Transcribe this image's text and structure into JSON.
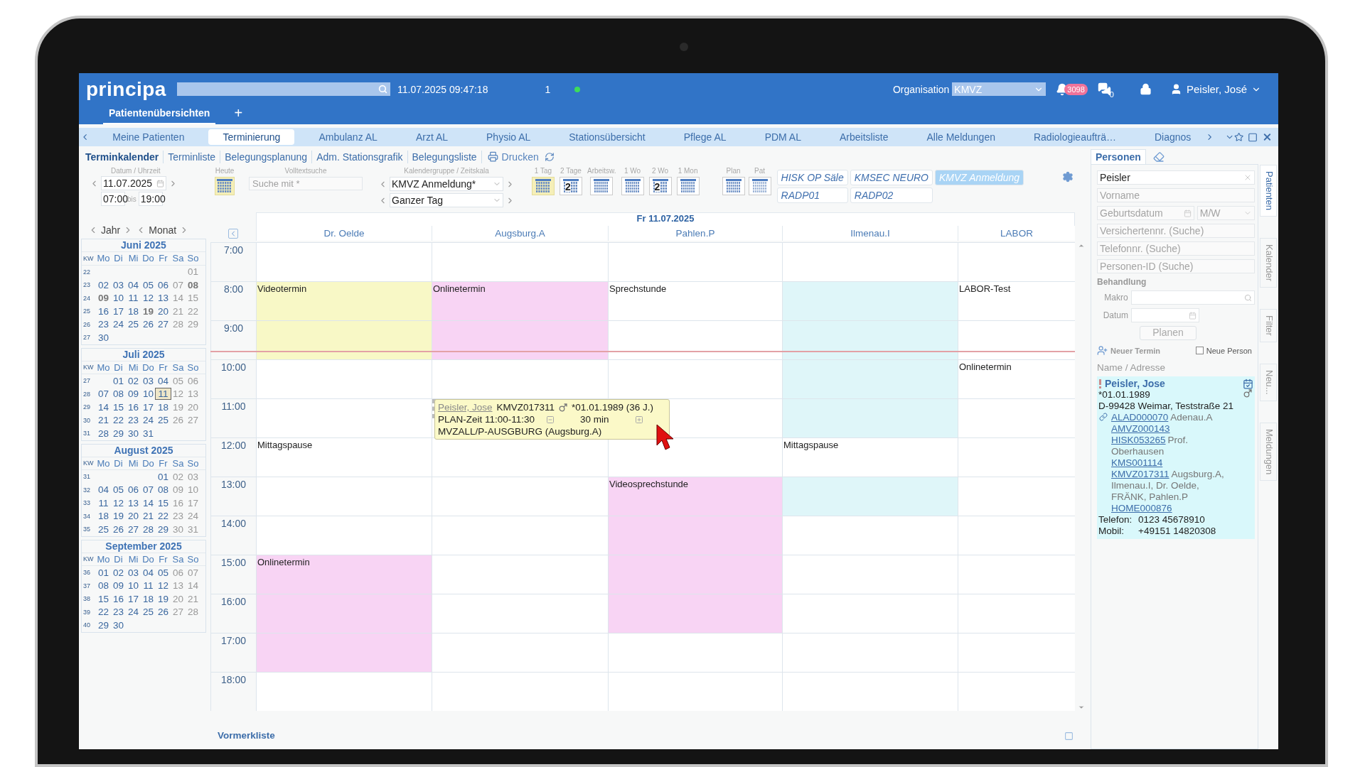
{
  "header": {
    "logo": "principa",
    "datetime": "11.07.2025 09:47:18",
    "session_count": "1",
    "organisation_label": "Organisation",
    "organisation_value": "KMVZ",
    "notifications": "3098",
    "messages": "0",
    "user": "Peisler, José"
  },
  "workspace_tabs": [
    {
      "label": "Patientenübersichten",
      "selected": true
    }
  ],
  "add_tab": "+",
  "nav_tabs": [
    {
      "label": "Meine Patienten",
      "selected": false
    },
    {
      "label": "Terminierung",
      "selected": true
    },
    {
      "label": "Ambulanz AL",
      "selected": false
    },
    {
      "label": "Arzt AL",
      "selected": false
    },
    {
      "label": "Physio AL",
      "selected": false
    },
    {
      "label": "Stationsübersicht",
      "selected": false
    },
    {
      "label": "Pflege AL",
      "selected": false
    },
    {
      "label": "PDM AL",
      "selected": false
    },
    {
      "label": "Arbeitsliste",
      "selected": false
    },
    {
      "label": "Alle Meldungen",
      "selected": false
    },
    {
      "label": "Radiologieaufträ…",
      "selected": false
    },
    {
      "label": "Diagnos",
      "selected": false
    }
  ],
  "sub_tabs": [
    {
      "label": "Terminkalender",
      "selected": true
    },
    {
      "label": "Terminliste",
      "selected": false
    },
    {
      "label": "Belegungsplanung",
      "selected": false
    },
    {
      "label": "Adm. Stationsgrafik",
      "selected": false
    },
    {
      "label": "Belegungsliste",
      "selected": false
    }
  ],
  "print": "Drucken",
  "date_controls": {
    "label": "Datum / Uhrzeit",
    "date": "11.07.2025",
    "time_from": "07:00",
    "bis": "bis",
    "time_to": "19:00"
  },
  "today": {
    "label": "Heute"
  },
  "fulltext": {
    "label": "Volltextsuche",
    "placeholder": "Suche mit *"
  },
  "group": {
    "label": "Kalendergruppe / Zeitskala",
    "value": "KMVZ Anmeldung*",
    "scale": "Ganzer Tag"
  },
  "views": [
    {
      "label": "1 Tag",
      "kind": "day",
      "selected": true
    },
    {
      "label": "2 Tage",
      "kind": "days",
      "digit": "2",
      "selected": false
    },
    {
      "label": "Arbeitsw.",
      "kind": "week",
      "selected": false
    },
    {
      "label": "1 Wo",
      "kind": "week",
      "selected": false
    },
    {
      "label": "2 Wo",
      "kind": "days",
      "digit": "2",
      "selected": false
    },
    {
      "label": "1 Mon",
      "kind": "month",
      "selected": false
    }
  ],
  "plan_views": [
    {
      "label": "Plan",
      "kind": "plan"
    },
    {
      "label": "Pat",
      "kind": "pat"
    }
  ],
  "groups": [
    {
      "label": "HISK OP Säle",
      "selected": false
    },
    {
      "label": "KMSEC NEURO",
      "selected": false
    },
    {
      "label": "KMVZ Anmeldung",
      "selected": true
    },
    {
      "label": "RADP01",
      "selected": false
    },
    {
      "label": "RADP02",
      "selected": false
    }
  ],
  "mini_nav": {
    "year": "Jahr",
    "month": "Monat"
  },
  "months": [
    {
      "title": "Juni 2025",
      "head": [
        "KW",
        "Mo",
        "Di",
        "Mi",
        "Do",
        "Fr",
        "Sa",
        "So"
      ],
      "weeks": [
        {
          "kw": "22",
          "days": [
            "01"
          ]
        },
        {
          "kw": "23",
          "days": [
            "02",
            "03",
            "04",
            "05",
            "06",
            "07",
            {
              "text": "08",
              "holiday": true
            }
          ]
        },
        {
          "kw": "24",
          "days": [
            {
              "text": "09",
              "holiday": true
            },
            "10",
            "11",
            "12",
            "13",
            "14",
            "15"
          ]
        },
        {
          "kw": "25",
          "days": [
            "16",
            "17",
            "18",
            {
              "text": "19",
              "holiday": true
            },
            "20",
            "21",
            "22"
          ]
        },
        {
          "kw": "26",
          "days": [
            "23",
            "24",
            "25",
            "26",
            "27",
            "28",
            "29"
          ]
        },
        {
          "kw": "27",
          "days": [
            "30"
          ]
        }
      ]
    },
    {
      "title": "Juli 2025",
      "head": [
        "KW",
        "Mo",
        "Di",
        "Mi",
        "Do",
        "Fr",
        "Sa",
        "So"
      ],
      "weeks": [
        {
          "kw": "27",
          "days": [
            "01",
            "02",
            "03",
            "04",
            "05",
            "06"
          ]
        },
        {
          "kw": "28",
          "days": [
            "07",
            "08",
            "09",
            "10",
            {
              "text": "11",
              "selected": true
            },
            "12",
            "13"
          ]
        },
        {
          "kw": "29",
          "days": [
            "14",
            "15",
            "16",
            "17",
            "18",
            "19",
            "20"
          ]
        },
        {
          "kw": "30",
          "days": [
            "21",
            "22",
            "23",
            "24",
            "25",
            "26",
            "27"
          ]
        },
        {
          "kw": "31",
          "days": [
            "28",
            "29",
            "30",
            "31"
          ]
        }
      ]
    },
    {
      "title": "August 2025",
      "head": [
        "KW",
        "Mo",
        "Di",
        "Mi",
        "Do",
        "Fr",
        "Sa",
        "So"
      ],
      "weeks": [
        {
          "kw": "31",
          "days": [
            "01",
            "02",
            "03"
          ]
        },
        {
          "kw": "32",
          "days": [
            "04",
            "05",
            "06",
            "07",
            "08",
            "09",
            "10"
          ]
        },
        {
          "kw": "33",
          "days": [
            "11",
            "12",
            "13",
            "14",
            "15",
            "16",
            "17"
          ]
        },
        {
          "kw": "34",
          "days": [
            "18",
            "19",
            "20",
            "21",
            "22",
            "23",
            "24"
          ]
        },
        {
          "kw": "35",
          "days": [
            "25",
            "26",
            "27",
            "28",
            "29",
            "30",
            "31"
          ]
        }
      ]
    },
    {
      "title": "September 2025",
      "head": [
        "KW",
        "Mo",
        "Di",
        "Mi",
        "Do",
        "Fr",
        "Sa",
        "So"
      ],
      "weeks": [
        {
          "kw": "36",
          "days": [
            "01",
            "02",
            "03",
            "04",
            "05",
            "06",
            "07"
          ]
        },
        {
          "kw": "37",
          "days": [
            "08",
            "09",
            "10",
            "11",
            "12",
            "13",
            "14"
          ]
        },
        {
          "kw": "38",
          "days": [
            "15",
            "16",
            "17",
            "18",
            "19",
            "20",
            "21"
          ]
        },
        {
          "kw": "39",
          "days": [
            "22",
            "23",
            "24",
            "25",
            "26",
            "27",
            "28"
          ]
        },
        {
          "kw": "40",
          "days": [
            "29",
            "30"
          ]
        }
      ]
    }
  ],
  "calendar": {
    "date": "Fr 11.07.2025",
    "times": [
      "7:00",
      "8:00",
      "9:00",
      "10:00",
      "11:00",
      "12:00",
      "13:00",
      "14:00",
      "15:00",
      "16:00",
      "17:00",
      "18:00"
    ],
    "columns": [
      {
        "name": "Dr. Oelde",
        "hours": [
          {
            "kind": "free"
          },
          {
            "kind": "event",
            "label": "Videotermin",
            "color": "#f8f8c6"
          },
          {
            "kind": "event",
            "color": "#f8f8c6"
          },
          {
            "kind": "free"
          },
          {
            "kind": "free"
          },
          {
            "kind": "event",
            "label": "Mittagspause"
          },
          {
            "kind": "free"
          },
          {
            "kind": "free"
          },
          {
            "kind": "event",
            "label": "Onlinetermin",
            "color": "#f8d4f4"
          },
          {
            "kind": "event",
            "color": "#f8d4f4"
          },
          {
            "kind": "event",
            "color": "#f8d4f4"
          },
          {
            "kind": "free"
          }
        ]
      },
      {
        "name": "Augsburg.A",
        "hours": [
          {
            "kind": "free"
          },
          {
            "kind": "event",
            "label": "Onlinetermin",
            "color": "#f8d4f4"
          },
          {
            "kind": "event",
            "color": "#f8d4f4"
          },
          {
            "kind": "free"
          },
          {
            "kind": "planned"
          },
          {
            "kind": "free"
          },
          {
            "kind": "free"
          },
          {
            "kind": "free"
          },
          {
            "kind": "free"
          },
          {
            "kind": "free"
          },
          {
            "kind": "free"
          },
          {
            "kind": "free"
          }
        ]
      },
      {
        "name": "Pahlen.P",
        "hours": [
          {
            "kind": "free"
          },
          {
            "kind": "event",
            "label": "Sprechstunde"
          },
          {
            "kind": "free"
          },
          {
            "kind": "free"
          },
          {
            "kind": "free"
          },
          {
            "kind": "free"
          },
          {
            "kind": "event",
            "label": "Videosprechstunde",
            "color": "#f8d4f4"
          },
          {
            "kind": "event",
            "color": "#f8d4f4"
          },
          {
            "kind": "event",
            "color": "#f8d4f4"
          },
          {
            "kind": "event",
            "color": "#f8d4f4"
          },
          {
            "kind": "free"
          },
          {
            "kind": "free"
          }
        ]
      },
      {
        "name": "Ilmenau.I",
        "hours": [
          {
            "kind": "free"
          },
          {
            "kind": "event",
            "color": "#dff6f9"
          },
          {
            "kind": "event",
            "color": "#dff6f9"
          },
          {
            "kind": "event",
            "color": "#dff6f9"
          },
          {
            "kind": "event",
            "color": "#dff6f9"
          },
          {
            "kind": "event",
            "label": "Mittagspause"
          },
          {
            "kind": "event",
            "color": "#dff6f9"
          },
          {
            "kind": "free"
          },
          {
            "kind": "free"
          },
          {
            "kind": "free"
          },
          {
            "kind": "free"
          },
          {
            "kind": "free"
          }
        ]
      },
      {
        "name": "LABOR",
        "hours": [
          {
            "kind": "free"
          },
          {
            "kind": "event",
            "label": "LABOR-Test"
          },
          {
            "kind": "free"
          },
          {
            "kind": "event",
            "label": "Onlinetermin"
          },
          {
            "kind": "free"
          },
          {
            "kind": "free"
          },
          {
            "kind": "free"
          },
          {
            "kind": "free"
          },
          {
            "kind": "free"
          },
          {
            "kind": "free"
          },
          {
            "kind": "free"
          },
          {
            "kind": "free"
          }
        ]
      }
    ],
    "tooltip": {
      "patient": "Peisler, Jose",
      "case": "KMVZ017311",
      "birth": "*01.01.1989  (36 J.)",
      "plan": "PLAN-Zeit 11:00-11:30",
      "duration": "30 min",
      "location": "MVZALL/P-AUSGBURG  (Augsburg.A)"
    }
  },
  "footer": {
    "label": "Vormerkliste"
  },
  "persons": {
    "tab": "Personen",
    "name_value": "Peisler",
    "firstname_placeholder": "Vorname",
    "birth_placeholder": "Geburtsdatum",
    "sex_placeholder": "M/W",
    "insurance_placeholder": "Versichertennr. (Suche)",
    "phone_placeholder": "Telefonnr. (Suche)",
    "id_placeholder": "Personen-ID (Suche)",
    "treatment": "Behandlung",
    "macro_label": "Makro",
    "date_label": "Datum",
    "plan_button": "Planen",
    "new_appointment": "Neuer Termin",
    "new_person": {
      "label": "Neue Person",
      "checked": false
    },
    "list_header": "Name / Adresse",
    "result": {
      "name": "Peisler, Jose",
      "birth": "*01.01.1989",
      "address": "D-99428 Weimar, Teststraße 21",
      "ids": [
        {
          "id": "ALAD000070",
          "note": "Adenau.A"
        },
        {
          "id": "AMVZ000143"
        },
        {
          "id": "HISK053265",
          "note": "Prof. Oberhausen"
        },
        {
          "id": "KMS001114"
        },
        {
          "id": "KMVZ017311",
          "note": "Augsburg.A, Ilmenau.I, Dr. Oelde, FRÄNK, Pahlen.P"
        },
        {
          "id": "HOME000876"
        }
      ],
      "phone_label": "Telefon:",
      "phone": "0123 45678910",
      "mobile_label": "Mobil:",
      "mobile": "+49151 14820308"
    }
  },
  "side_tabs": [
    {
      "label": "Patienten",
      "selected": true
    },
    {
      "label": "Kalender",
      "selected": false
    },
    {
      "label": "Filter",
      "selected": false
    },
    {
      "label": "Neu...",
      "selected": false
    },
    {
      "label": "Meldungen",
      "selected": false
    }
  ]
}
